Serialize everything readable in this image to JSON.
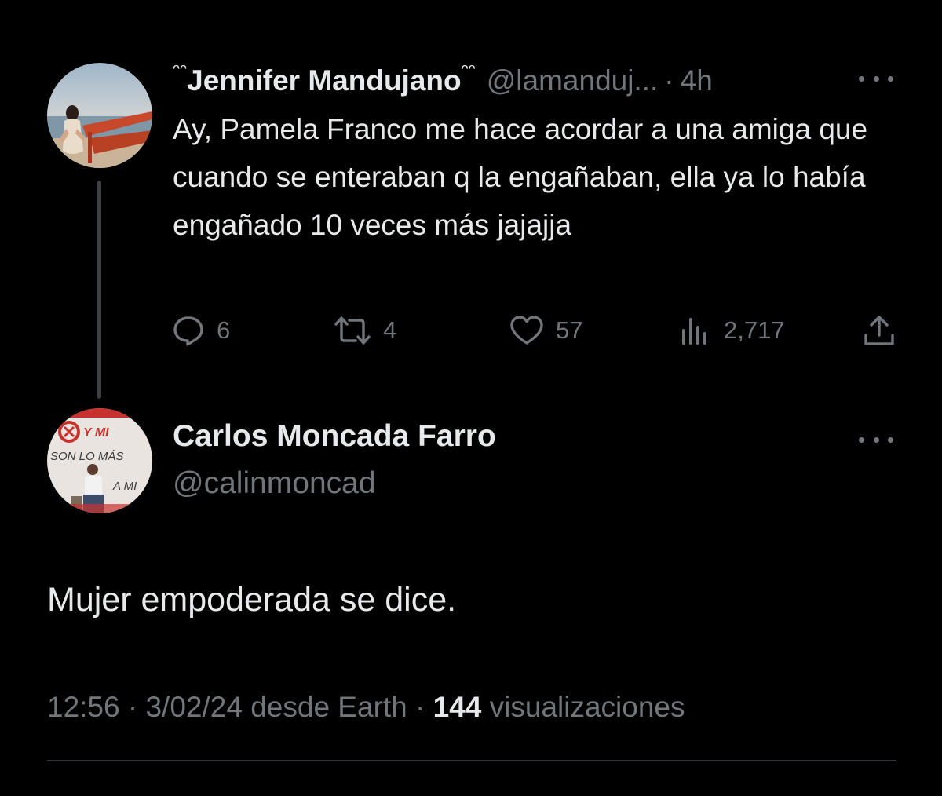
{
  "parent_tweet": {
    "display_name": "Jennifer Mandujano",
    "name_decoration": "ᵔᵔ",
    "handle": "@lamanduj...",
    "separator": "·",
    "time": "4h",
    "text": "Ay, Pamela Franco me hace acordar a una amiga que cuando se enteraban q la engañaban, ella ya lo había engañado 10 veces más jajajja",
    "replies": "6",
    "reposts": "4",
    "likes": "57",
    "views": "2,717"
  },
  "main_tweet": {
    "display_name": "Carlos Moncada Farro",
    "handle": "@calinmoncad",
    "text": "Mujer empoderada se dice.",
    "time": "12:56",
    "date": "3/02/24",
    "source": "desde Earth",
    "separator": "·",
    "views_count": "144",
    "views_label": "visualizaciones",
    "avatar_sign_lines": [
      "Y MI",
      "SON LO MÁS",
      "A MI"
    ]
  },
  "colors": {
    "background": "#000000",
    "text_primary": "#e7e9ea",
    "text_secondary": "#71767b",
    "divider": "#2f3336"
  },
  "icons": {
    "reply": "speech-bubble-icon",
    "repost": "repost-arrows-icon",
    "like": "heart-icon",
    "views": "bar-chart-icon",
    "share": "share-upload-icon",
    "more": "more-dots-icon"
  }
}
